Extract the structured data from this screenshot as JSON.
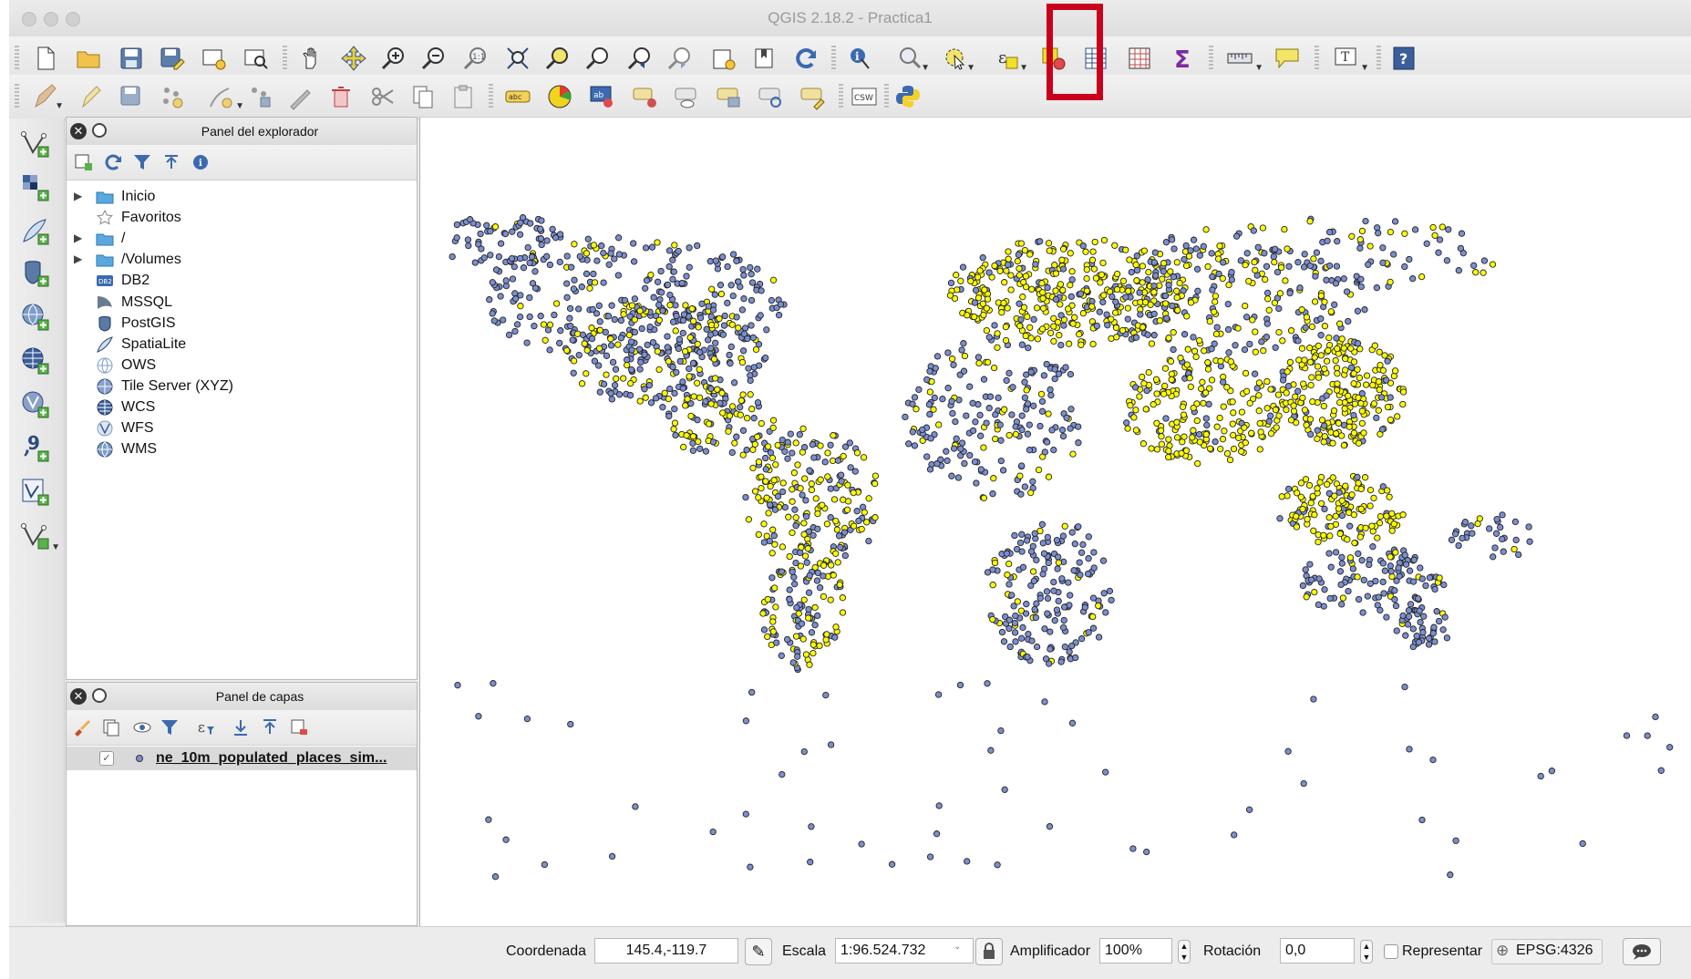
{
  "window": {
    "title": "QGIS 2.18.2 - Practica1"
  },
  "toolbar_main": {
    "icons": [
      "new-project-icon",
      "open-project-icon",
      "save-project-icon",
      "save-as-icon",
      "new-print-composer-icon",
      "composer-manager-icon",
      "pan-icon",
      "pan-to-selection-icon",
      "zoom-in-icon",
      "zoom-out-icon",
      "zoom-actual-icon",
      "zoom-full-icon",
      "zoom-to-selection-icon",
      "zoom-to-layer-icon",
      "zoom-last-icon",
      "zoom-next-icon",
      "new-map-view-icon",
      "bookmark-icon",
      "refresh-icon",
      "identify-icon",
      "select-features-icon",
      "select-by-expression-icon",
      "deselect-icon",
      "attribute-table-icon",
      "field-calculator-icon",
      "statistics-icon",
      "measure-icon",
      "map-tips-icon",
      "text-annotation-icon",
      "help-icon"
    ]
  },
  "toolbar_edit": {
    "icons": [
      "current-edits-icon",
      "toggle-editing-icon",
      "save-edits-icon",
      "add-feature-icon",
      "node-tool-icon",
      "move-feature-icon",
      "digitize-icon",
      "delete-selected-icon",
      "cut-features-icon",
      "copy-features-icon",
      "paste-features-icon",
      "layer-labeling-icon",
      "style-icon",
      "label-pin-icon",
      "label-highlight-icon",
      "label-show-hide-icon",
      "label-move-icon",
      "label-rotate-icon",
      "label-change-icon",
      "csw-icon",
      "python-console-icon"
    ],
    "csw_label": "CSW",
    "abc_label": "abc"
  },
  "vertical_toolbar": {
    "icons": [
      "add-vector-layer-icon",
      "add-raster-layer-icon",
      "add-spatialite-layer-icon",
      "add-postgis-layer-icon",
      "add-wms-layer-icon",
      "add-wcs-layer-icon",
      "add-wfs-layer-icon",
      "add-delimited-text-icon",
      "new-shapefile-icon",
      "add-virtual-layer-icon"
    ]
  },
  "browser_panel": {
    "title": "Panel del explorador",
    "tools": [
      "add-selected-icon",
      "refresh-icon",
      "filter-icon",
      "collapse-all-icon",
      "properties-icon"
    ],
    "items": [
      {
        "label": "Inicio",
        "icon": "folder-icon",
        "expandable": true
      },
      {
        "label": "Favoritos",
        "icon": "star-icon",
        "expandable": false
      },
      {
        "label": "/",
        "icon": "folder-icon",
        "expandable": true
      },
      {
        "label": "/Volumes",
        "icon": "folder-icon",
        "expandable": true
      },
      {
        "label": "DB2",
        "icon": "db2-icon",
        "expandable": false
      },
      {
        "label": "MSSQL",
        "icon": "mssql-icon",
        "expandable": false
      },
      {
        "label": "PostGIS",
        "icon": "postgis-icon",
        "expandable": false
      },
      {
        "label": "SpatiaLite",
        "icon": "spatialite-icon",
        "expandable": false
      },
      {
        "label": "OWS",
        "icon": "ows-icon",
        "expandable": false
      },
      {
        "label": "Tile Server (XYZ)",
        "icon": "xyz-icon",
        "expandable": false
      },
      {
        "label": "WCS",
        "icon": "wcs-icon",
        "expandable": false
      },
      {
        "label": "WFS",
        "icon": "wfs-icon",
        "expandable": false
      },
      {
        "label": "WMS",
        "icon": "wms-icon",
        "expandable": false
      }
    ]
  },
  "layers_panel": {
    "title": "Panel de capas",
    "tools": [
      "open-styling-icon",
      "add-group-icon",
      "manage-visibility-icon",
      "filter-legend-icon",
      "filter-expression-icon",
      "expand-all-icon",
      "collapse-all-icon",
      "remove-layer-icon"
    ],
    "layers": [
      {
        "name": "ne_10m_populated_places_sim...",
        "checked": true
      }
    ]
  },
  "map": {
    "point_colors": {
      "selected": "#ffff00",
      "unselected": "#7b8fd0",
      "outline": "#222222"
    }
  },
  "statusbar": {
    "coordinate_label": "Coordenada",
    "coordinate_value": "145.4,-119.7",
    "scale_label": "Escala",
    "scale_value": "1:96.524.732",
    "magnifier_label": "Amplificador",
    "magnifier_value": "100%",
    "rotation_label": "Rotación",
    "rotation_value": "0,0",
    "render_label": "Representar",
    "crs_label": "EPSG:4326"
  },
  "colors": {
    "highlight": "#c8001c"
  }
}
